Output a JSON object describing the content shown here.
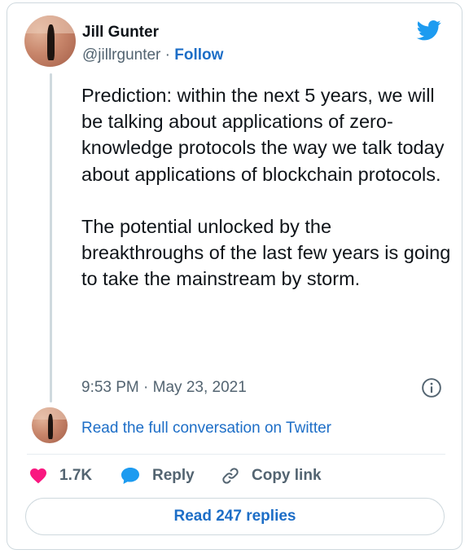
{
  "author": {
    "name": "Jill Gunter",
    "handle": "@jillrgunter",
    "separator": " · ",
    "follow_label": "Follow"
  },
  "tweet": {
    "text": "Prediction: within the next 5 years, we will be talking about applications of zero-knowledge protocols the way we talk today about applications of blockchain protocols.\n\nThe potential unlocked by the breakthroughs of the last few years is going to take the mainstream by storm.",
    "timestamp": "9:53 PM · May 23, 2021"
  },
  "conversation": {
    "read_full_label": "Read the full conversation on Twitter"
  },
  "actions": {
    "like_count": "1.7K",
    "reply_label": "Reply",
    "copy_link_label": "Copy link"
  },
  "footer": {
    "read_replies_label": "Read 247 replies"
  },
  "icons": {
    "brand": "twitter-bird-icon",
    "info": "info-icon",
    "like": "heart-icon",
    "reply": "speech-bubble-icon",
    "copy": "link-icon"
  },
  "colors": {
    "brand_blue": "#1d9bf0",
    "link_blue": "#1d6ec7",
    "like_pink": "#f91880",
    "muted": "#536471",
    "border": "#cfd9de"
  }
}
